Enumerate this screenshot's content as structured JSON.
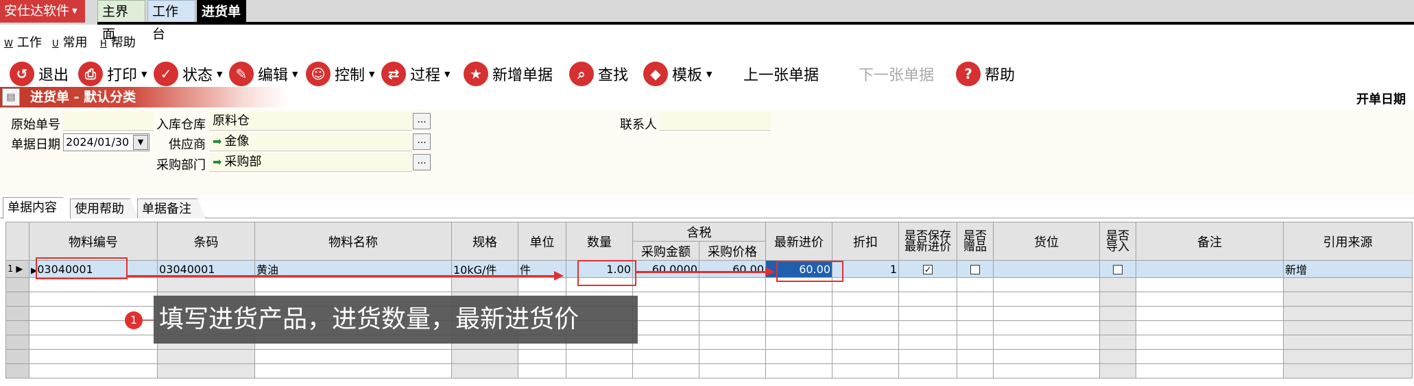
{
  "app_menu": "安仕达软件",
  "tabs": [
    "主界面",
    "工作台",
    "进货单"
  ],
  "menu": [
    {
      "key": "W",
      "label": "工作"
    },
    {
      "key": "U",
      "label": "常用"
    },
    {
      "key": "H",
      "label": "帮助"
    }
  ],
  "toolbar": {
    "exit": "退出",
    "print": "打印",
    "status": "状态",
    "edit": "编辑",
    "control": "控制",
    "process": "过程",
    "new_doc": "新增单据",
    "find": "查找",
    "template": "模板",
    "prev_doc": "上一张单据",
    "next_doc": "下一张单据",
    "help": "帮助"
  },
  "section_title": "进货单 - 默认分类",
  "open_date_label": "开单日期",
  "form": {
    "original_no_label": "原始单号",
    "original_no": "",
    "doc_date_label": "单据日期",
    "doc_date": "2024/01/30",
    "warehouse_label": "入库仓库",
    "warehouse": "原料仓",
    "supplier_label": "供应商",
    "supplier": "金像",
    "dept_label": "采购部门",
    "dept": "采购部",
    "contact_label": "联系人",
    "contact": ""
  },
  "subtabs": [
    "单据内容",
    "使用帮助",
    "单据备注"
  ],
  "grid": {
    "headers": {
      "code": "物料编号",
      "barcode": "条码",
      "name": "物料名称",
      "spec": "规格",
      "unit": "单位",
      "qty": "数量",
      "tax_group": "含税",
      "amount": "采购金额",
      "price": "采购价格",
      "latest_price": "最新进价",
      "discount": "折扣",
      "save_latest": "是否保存最新进价",
      "gift": "是否赠品",
      "location": "货位",
      "import": "是否导入",
      "remark": "备注",
      "source": "引用来源"
    },
    "row1": {
      "no": "1",
      "code": "03040001",
      "barcode": "03040001",
      "name": "黄油",
      "spec": "10kG/件",
      "unit": "件",
      "qty": "1.00",
      "amount": "60.0000",
      "price": "60.00",
      "latest_price": "60.00",
      "discount": "1",
      "source": "新增"
    }
  },
  "callout": {
    "number": "1",
    "text": "填写进货产品，进货数量，最新进货价"
  },
  "colors": {
    "accent": "#d63030",
    "selection": "#cfe3f5",
    "highlight": "#1f5fae"
  }
}
